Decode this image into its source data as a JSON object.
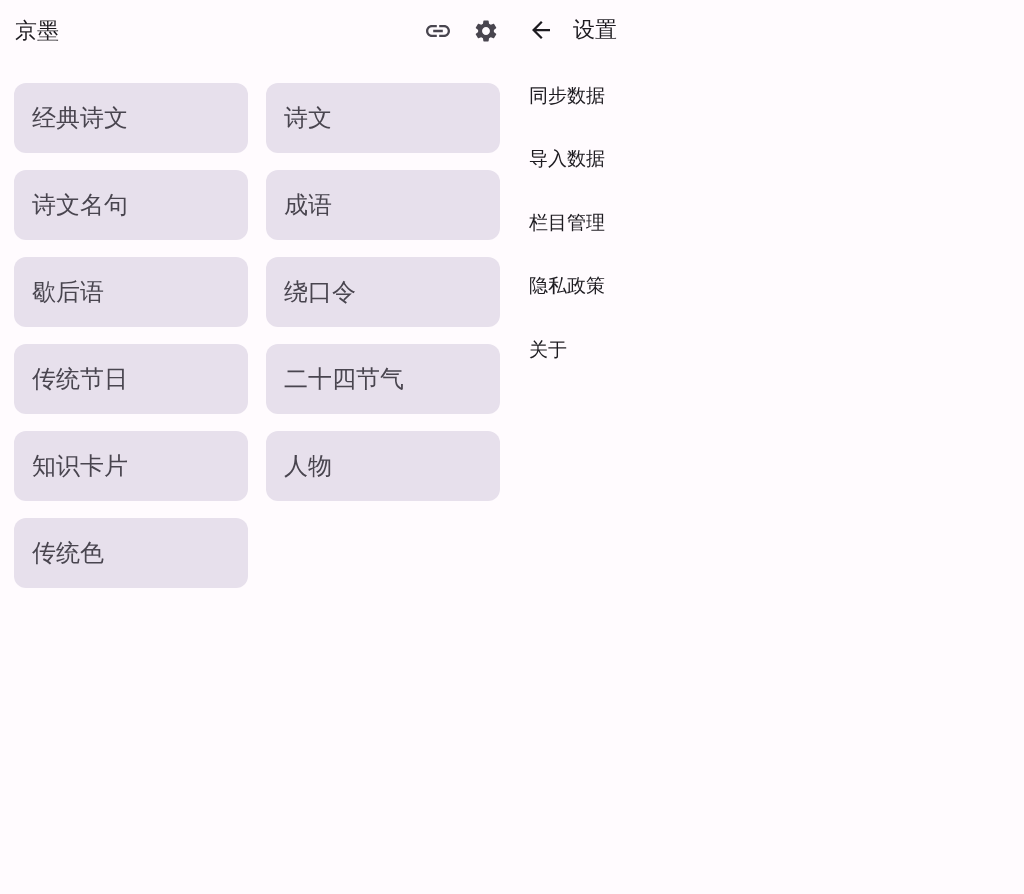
{
  "app_bar": {
    "title": "京墨"
  },
  "categories": [
    {
      "label": "经典诗文"
    },
    {
      "label": "诗文"
    },
    {
      "label": "诗文名句"
    },
    {
      "label": "成语"
    },
    {
      "label": "歇后语"
    },
    {
      "label": "绕口令"
    },
    {
      "label": "传统节日"
    },
    {
      "label": "二十四节气"
    },
    {
      "label": "知识卡片"
    },
    {
      "label": "人物"
    },
    {
      "label": "传统色"
    }
  ],
  "settings": {
    "title": "设置",
    "items": [
      {
        "label": "同步数据"
      },
      {
        "label": "导入数据"
      },
      {
        "label": "栏目管理"
      },
      {
        "label": "隐私政策"
      },
      {
        "label": "关于"
      }
    ]
  }
}
